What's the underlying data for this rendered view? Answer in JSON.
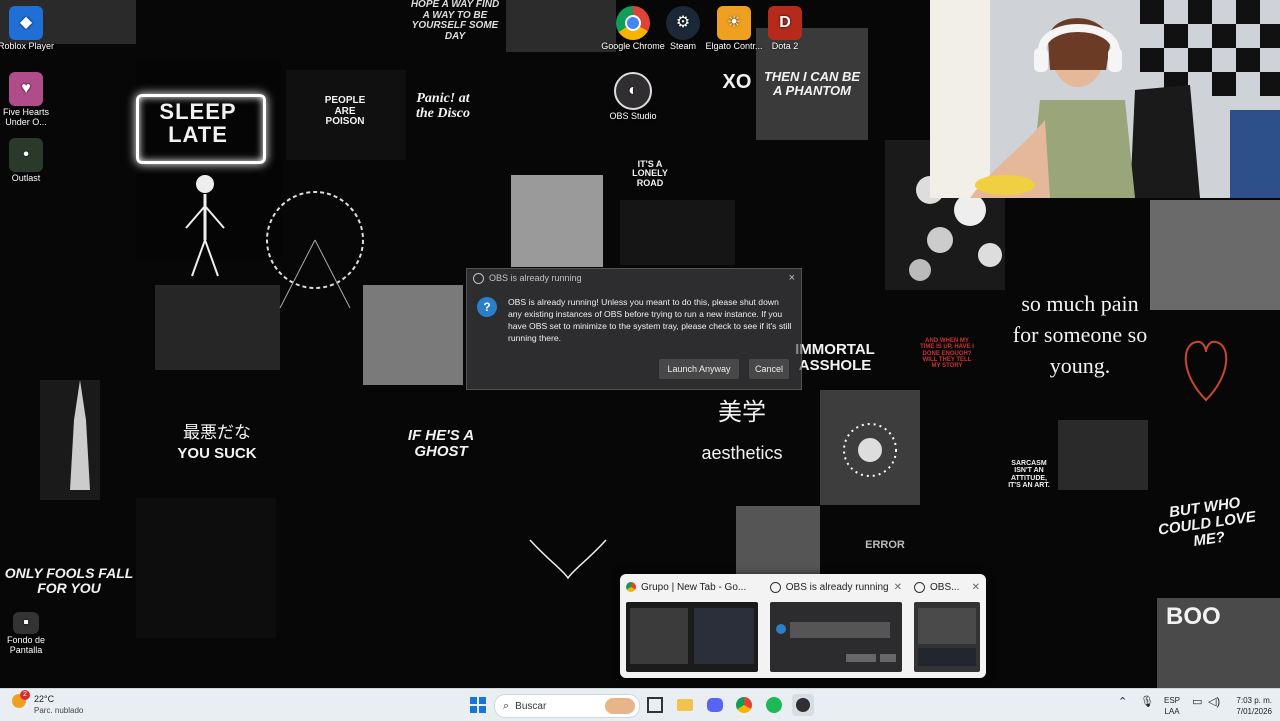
{
  "desktop": {
    "icons_left": [
      {
        "label": "Roblox Player",
        "icon": "roblox-icon",
        "color": "#1f6fd6"
      },
      {
        "label": "Five Hearts Under O...",
        "icon": "game-icon",
        "color": "#b04c8a"
      },
      {
        "label": "Outlast",
        "icon": "outlast-icon",
        "color": "#2a3a2a"
      },
      {
        "label": "Fondo de Pantalla",
        "icon": "image-icon",
        "color": "#333333"
      }
    ],
    "icons_top": [
      {
        "label": "Google Chrome",
        "icon": "chrome-icon",
        "color": "#db4437"
      },
      {
        "label": "Steam",
        "icon": "steam-icon",
        "color": "#1b2838"
      },
      {
        "label": "Elgato Contr...",
        "icon": "elgato-icon",
        "color": "#f0a020"
      },
      {
        "label": "Dota 2",
        "icon": "dota-icon",
        "color": "#b52a1a"
      },
      {
        "label": "OBS Studio",
        "icon": "obs-icon",
        "color": "#302e31"
      }
    ]
  },
  "wallpaper": {
    "texts": {
      "sleep_late": "SLEEP LATE",
      "people_poison": "PEOPLE ARE POISON",
      "panic_disco": "Panic! at the Disco",
      "phantom": "THEN I CAN BE A PHANTOM",
      "hope": "HOPE A WAY FIND A WAY TO BE YOURSELF SOME DAY",
      "so_much_pain": "so much pain for someone so young.",
      "immortal": "IMMORTAL ASSHOLE",
      "bijinakute": "最悪だな",
      "you_suck": "YOU SUCK",
      "ghost": "IF HE'S A GHOST",
      "bigaku": "美学",
      "aesthetics": "aesthetics",
      "but_who": "BUT WHO COULD LOVE ME?",
      "only_fools": "ONLY FOOLS FALL FOR YOU",
      "sarcasm": "SARCASM ISN'T AN ATTITUDE, IT'S AN ART.",
      "when_my_time": "AND WHEN MY TIME IS UP, HAVE I DONE ENOUGH? WILL THEY TELL MY STORY",
      "lonely": "IT'S A LONELY ROAD",
      "error": "ERROR",
      "boo": "BOO",
      "xo": "XO"
    }
  },
  "dialog": {
    "title": "OBS is already running",
    "message": "OBS is already running! Unless you meant to do this, please shut down any existing instances of OBS before trying to run a new instance. If you have OBS set to minimize to the system tray, please check to see if it's still running there.",
    "launch_anyway": "Launch Anyway",
    "cancel": "Cancel",
    "close": "×"
  },
  "taskbar_thumbs": [
    {
      "title": "Grupo | New Tab - Go...",
      "icon": "chrome-icon"
    },
    {
      "title": "OBS is already running",
      "icon": "obs-icon"
    },
    {
      "title": "OBS...",
      "icon": "obs-icon"
    }
  ],
  "taskbar": {
    "weather_temp": "22°C",
    "weather_desc": "Parc. nublado",
    "search_placeholder": "Buscar",
    "lang_top": "ESP",
    "lang_bottom": "LAA",
    "time": "7:03 p. m.",
    "date": "7/01/2026",
    "weather_badge": "2"
  },
  "colors": {
    "accent": "#2a7fc9",
    "taskbar_bg": "#e9eef3"
  }
}
